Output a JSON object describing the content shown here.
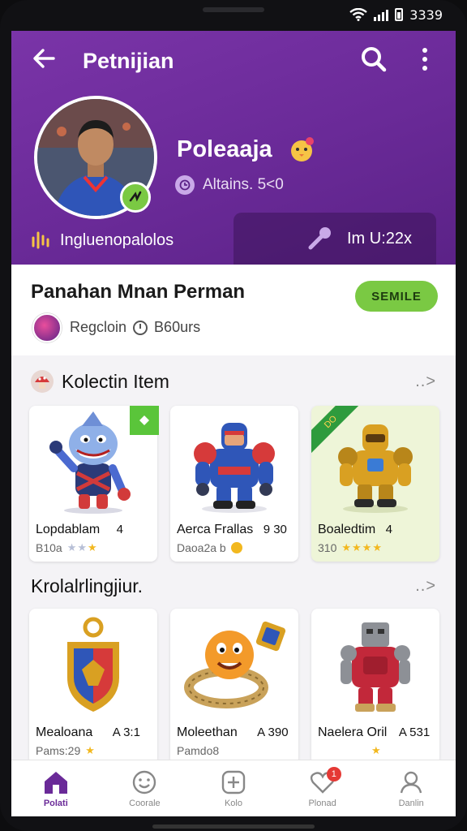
{
  "status_bar": {
    "time": "3339"
  },
  "header": {
    "title": "Petnijian",
    "profile_name": "Poleaaja",
    "meta_text": "Altains. 5<0",
    "tab_left_label": "Ingluenopalolos",
    "tab_right_label": "Im U:22x"
  },
  "game": {
    "title": "Panahan Mnan Perman",
    "button_label": "SEMILE",
    "region": "Regcloin",
    "time_text": "B60urs"
  },
  "collection": {
    "title": "Kolectin Item",
    "more": "..>",
    "items": [
      {
        "name": "Lopdablam",
        "tag": "4",
        "sub": "B10a",
        "rating": 3,
        "rating_shown": 2
      },
      {
        "name": "Aerca Frallas",
        "tag": "9  30",
        "sub": "Daoa2a b",
        "rating": 1
      },
      {
        "name": "Boaledtim",
        "tag": "4",
        "sub": "310",
        "rating": 4,
        "ribbon": "DO"
      }
    ]
  },
  "second": {
    "title": "Krolalrlingjiur.",
    "more": "..>",
    "items": [
      {
        "name": "Mealoana",
        "tag": "A  3:1",
        "sub": "Pams:29"
      },
      {
        "name": "Moleethan",
        "tag": "A  390",
        "sub": "Pamdo8"
      },
      {
        "name": "Naelera Oril",
        "tag": "A  531",
        "sub": ""
      }
    ]
  },
  "nav": [
    {
      "label": "Polati",
      "icon": "home-icon"
    },
    {
      "label": "Coorale",
      "icon": "smile-icon"
    },
    {
      "label": "Kolo",
      "icon": "game-icon"
    },
    {
      "label": "Plonad",
      "icon": "heart-icon",
      "badge": "1"
    },
    {
      "label": "Danlin",
      "icon": "profile-icon"
    }
  ],
  "colors": {
    "primary": "#6a2a98",
    "accent": "#7ac943",
    "star": "#f2b81f"
  }
}
